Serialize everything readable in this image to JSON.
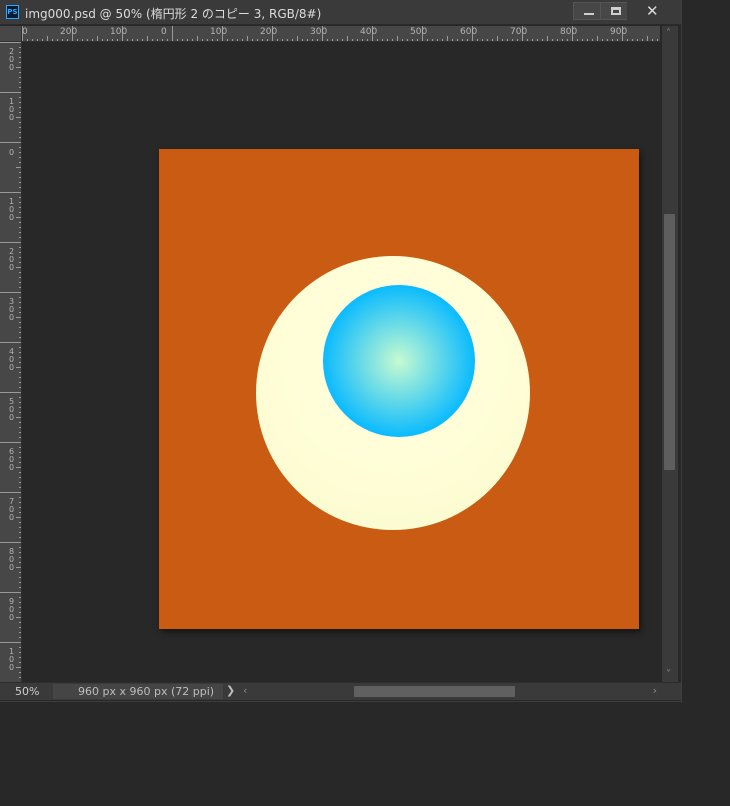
{
  "window": {
    "app_icon": "PS",
    "title": "img000.psd @ 50% (楕円形 2 のコピー 3, RGB/8#)",
    "close_glyph": "✕"
  },
  "ruler": {
    "horizontal_labels": [
      "0",
      "200",
      "100",
      "0",
      "100",
      "200",
      "300",
      "400",
      "500",
      "600",
      "700",
      "800",
      "900"
    ],
    "vertical_labels": [
      "200",
      "100",
      "0",
      "100",
      "200",
      "300",
      "400",
      "500",
      "600",
      "700",
      "800",
      "900",
      "100"
    ]
  },
  "canvas": {
    "background_color": "#ca5b13",
    "outer_circle_color": "#fffed8",
    "outer_circle_edge_color": "#fafacd",
    "inner_circle_center_color": "#c6fbd0",
    "inner_circle_edge_color": "#06b9ff"
  },
  "status": {
    "zoom": "50%",
    "doc_info": "960 px x 960 px (72 ppi)",
    "chevron": "❯"
  },
  "scroll": {
    "up_arrow": "˄",
    "down_arrow": "˅",
    "left_arrow": "‹",
    "right_arrow": "›"
  }
}
